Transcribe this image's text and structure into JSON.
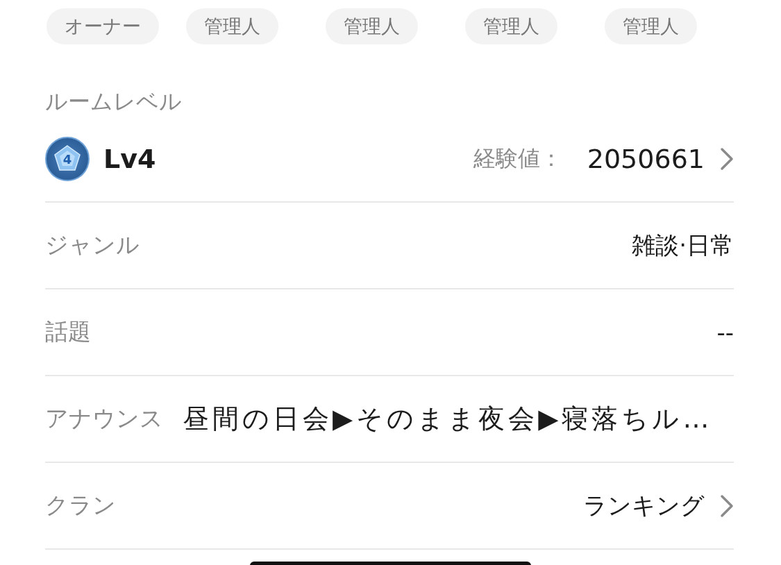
{
  "roles": [
    {
      "label": "オーナー"
    },
    {
      "label": "管理人"
    },
    {
      "label": "管理人"
    },
    {
      "label": "管理人"
    },
    {
      "label": "管理人"
    }
  ],
  "room_level": {
    "heading": "ルームレベル",
    "badge": "4",
    "level": "Lv4",
    "exp_label": "経験値：",
    "exp_value": "2050661"
  },
  "rows": [
    {
      "kind": "right",
      "label": "ジャンル",
      "value": "雑談·日常",
      "chevron": false
    },
    {
      "kind": "right",
      "label": "話題",
      "value": "--",
      "chevron": false
    },
    {
      "kind": "left",
      "label": "アナウンス",
      "value": "昼間の日会▶そのまま夜会▶寝落ちル…",
      "chevron": false
    },
    {
      "kind": "right",
      "label": "クラン",
      "value": "ランキング",
      "chevron": true
    }
  ]
}
